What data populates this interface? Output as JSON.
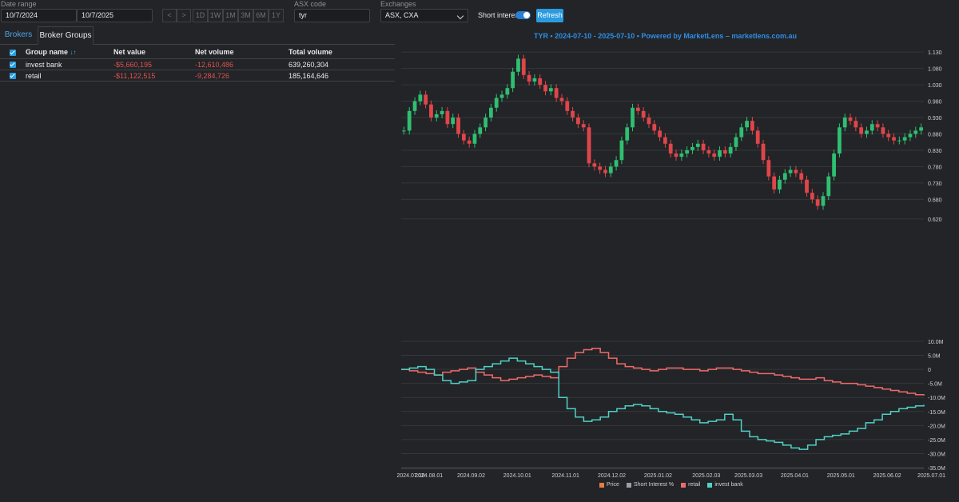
{
  "filters": {
    "date_range_label": "Date range",
    "date_from": "10/7/2024",
    "date_to": "10/7/2025",
    "prev_label": "<",
    "next_label": ">",
    "ranges": [
      "1D",
      "1W",
      "1M",
      "3M",
      "6M",
      "1Y"
    ],
    "asx_code_label": "ASX code",
    "asx_code": "tyr",
    "exchanges_label": "Exchanges",
    "exchanges_value": "ASX, CXA",
    "short_interest_label": "Short interest",
    "short_interest_on": true,
    "refresh_label": "Refresh"
  },
  "tabs": [
    "Brokers",
    "Broker Groups"
  ],
  "table": {
    "columns": [
      "Group name",
      "Net value",
      "Net volume",
      "Total volume"
    ],
    "sort_indicator": "↓↑",
    "rows": [
      {
        "name": "invest bank",
        "net_value": "-$5,660,195",
        "net_volume": "-12,610,486",
        "total_volume": "639,260,304"
      },
      {
        "name": "retail",
        "net_value": "-$11,122,515",
        "net_volume": "-9,284,726",
        "total_volume": "185,164,646"
      }
    ]
  },
  "chart_data": {
    "type": "line",
    "title": "TYR • 2024-07-10 - 2025-07-10 • Powered by MarketLens – marketlens.com.au",
    "x_ticks": [
      "2024.07.10",
      "2024.08.01",
      "2024.09.02",
      "2024.10.01",
      "2024.11.01",
      "2024.12.02",
      "2025.01.02",
      "2025.02.03",
      "2025.03.03",
      "2025.04.01",
      "2025.05.01",
      "2025.06.02",
      "2025.07.01"
    ],
    "price_axis": {
      "ticks": [
        "1.130",
        "1.080",
        "1.030",
        "0.980",
        "0.930",
        "0.880",
        "0.830",
        "0.780",
        "0.730",
        "0.680",
        "0.620"
      ],
      "ylim": [
        0.61,
        1.15
      ]
    },
    "volume_axis": {
      "ticks": [
        "10.0M",
        "5.0M",
        "0",
        "-5.0M",
        "-10.0M",
        "-15.0M",
        "-20.0M",
        "-25.0M",
        "-30.0M",
        "-35.0M"
      ],
      "ylim": [
        -35,
        10
      ]
    },
    "price_close": [
      0.89,
      0.95,
      0.98,
      1.0,
      0.97,
      0.93,
      0.94,
      0.95,
      0.91,
      0.93,
      0.88,
      0.86,
      0.85,
      0.88,
      0.9,
      0.93,
      0.96,
      0.99,
      1.0,
      1.02,
      1.07,
      1.11,
      1.06,
      1.04,
      1.05,
      1.03,
      1.01,
      1.02,
      0.99,
      0.98,
      0.95,
      0.93,
      0.91,
      0.9,
      0.79,
      0.78,
      0.77,
      0.76,
      0.78,
      0.8,
      0.86,
      0.9,
      0.96,
      0.95,
      0.93,
      0.91,
      0.89,
      0.87,
      0.85,
      0.82,
      0.81,
      0.82,
      0.83,
      0.84,
      0.85,
      0.83,
      0.82,
      0.81,
      0.83,
      0.82,
      0.84,
      0.87,
      0.9,
      0.92,
      0.89,
      0.85,
      0.8,
      0.75,
      0.71,
      0.74,
      0.76,
      0.77,
      0.76,
      0.74,
      0.7,
      0.68,
      0.66,
      0.69,
      0.75,
      0.82,
      0.9,
      0.93,
      0.92,
      0.9,
      0.88,
      0.89,
      0.91,
      0.9,
      0.88,
      0.87,
      0.86,
      0.86,
      0.87,
      0.88,
      0.89,
      0.9
    ],
    "series": [
      {
        "name": "Price",
        "color": "#e87c3e"
      },
      {
        "name": "Short Interest %",
        "color": "#9aa0a6"
      },
      {
        "name": "retail",
        "color": "#f06a6a",
        "values": [
          0,
          -0.5,
          -1,
          -1.5,
          -2,
          -1,
          -0.5,
          0,
          0.5,
          -1,
          -2,
          -3,
          -4,
          -3.5,
          -3,
          -2.5,
          -2,
          -2.5,
          -3,
          1,
          4,
          6,
          7,
          7.5,
          6,
          4,
          2,
          1,
          0.5,
          0,
          -0.5,
          0,
          0.5,
          0.5,
          0,
          0,
          -0.5,
          0,
          0.5,
          0.5,
          0,
          -0.5,
          -1,
          -1.5,
          -1.5,
          -2,
          -2.5,
          -3,
          -3.5,
          -3.5,
          -3,
          -4,
          -4.5,
          -5,
          -5,
          -5.5,
          -6,
          -6.5,
          -7,
          -7.5,
          -8,
          -8.5,
          -9,
          -9.28
        ]
      },
      {
        "name": "invest bank",
        "color": "#4fd1c5",
        "values": [
          0,
          0.5,
          1,
          0,
          -2,
          -4,
          -5,
          -4.5,
          -4,
          0,
          1,
          2,
          3,
          4,
          3,
          2,
          1,
          0,
          -1,
          -10,
          -14,
          -17,
          -18.5,
          -18,
          -17,
          -15,
          -14,
          -13,
          -12.5,
          -13,
          -14,
          -15,
          -15.5,
          -16,
          -17,
          -18,
          -19,
          -18.5,
          -18,
          -16,
          -18,
          -22,
          -24,
          -25,
          -25.5,
          -26,
          -27,
          -28,
          -28.5,
          -27,
          -25,
          -24,
          -23.5,
          -23,
          -22,
          -21,
          -19,
          -18,
          -16,
          -15,
          -14,
          -13.5,
          -13,
          -12.61
        ]
      }
    ]
  }
}
